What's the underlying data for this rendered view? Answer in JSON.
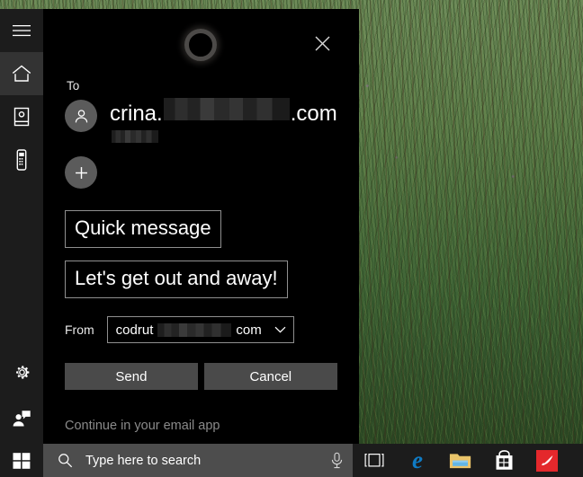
{
  "colors": {
    "panel_bg": "#000000",
    "rail_bg": "#1c1c1c",
    "rail_active": "#333333",
    "button_bg": "#4a4a4a",
    "search_bg": "#4d4d4d",
    "edge_blue": "#0f7bc4",
    "paint3d_red": "#e4282c",
    "text_primary": "#ffffff",
    "text_muted": "#8a8a8a"
  },
  "rail": {
    "items": [
      {
        "name": "hamburger-menu",
        "icon": "hamburger-icon",
        "active": false
      },
      {
        "name": "home",
        "icon": "home-icon",
        "active": true
      },
      {
        "name": "notebook",
        "icon": "notebook-icon",
        "active": false
      },
      {
        "name": "devices",
        "icon": "device-icon",
        "active": false
      }
    ],
    "bottom_items": [
      {
        "name": "settings",
        "icon": "gear-icon"
      },
      {
        "name": "feedback",
        "icon": "feedback-person-icon"
      }
    ]
  },
  "panel": {
    "logo": "cortana-ring-icon",
    "close_label": "close-icon",
    "to_label": "To",
    "recipient": {
      "name_prefix": "crina.",
      "name_suffix": ".com",
      "redacted_primary": true,
      "redacted_secondary": true,
      "avatar_icon": "person-icon"
    },
    "add_recipient_label": "+",
    "subject_value": "Quick message",
    "body_value": "Let's get out and away!",
    "from_label": "From",
    "from_value_prefix": "codrut",
    "from_value_suffix": "com",
    "from_chevron": "chevron-down-icon",
    "send_label": "Send",
    "cancel_label": "Cancel",
    "continue_label": "Continue in your email app"
  },
  "taskbar": {
    "start_label": "windows-logo-icon",
    "search_placeholder": "Type here to search",
    "search_icon": "search-icon",
    "mic_icon": "microphone-icon",
    "icons": [
      {
        "name": "task-view",
        "label": "task-view-icon"
      },
      {
        "name": "microsoft-edge",
        "label": "e"
      },
      {
        "name": "file-explorer",
        "label": "folder-icon"
      },
      {
        "name": "microsoft-store",
        "label": "store-bag-icon"
      },
      {
        "name": "paint-3d",
        "label": "paint-3d-icon"
      }
    ]
  }
}
